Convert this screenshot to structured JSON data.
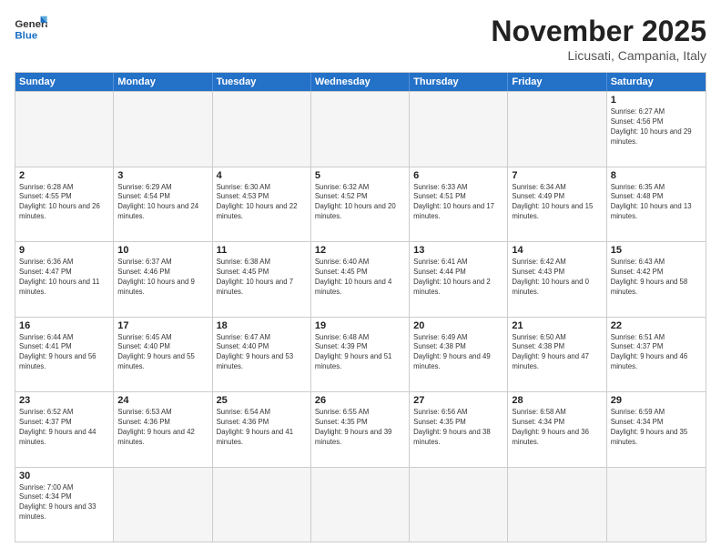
{
  "header": {
    "logo_general": "General",
    "logo_blue": "Blue",
    "month_title": "November 2025",
    "location": "Licusati, Campania, Italy"
  },
  "weekdays": [
    "Sunday",
    "Monday",
    "Tuesday",
    "Wednesday",
    "Thursday",
    "Friday",
    "Saturday"
  ],
  "rows": [
    [
      {
        "day": "",
        "info": "",
        "empty": true
      },
      {
        "day": "",
        "info": "",
        "empty": true
      },
      {
        "day": "",
        "info": "",
        "empty": true
      },
      {
        "day": "",
        "info": "",
        "empty": true
      },
      {
        "day": "",
        "info": "",
        "empty": true
      },
      {
        "day": "",
        "info": "",
        "empty": true
      },
      {
        "day": "1",
        "info": "Sunrise: 6:27 AM\nSunset: 4:56 PM\nDaylight: 10 hours and 29 minutes."
      }
    ],
    [
      {
        "day": "2",
        "info": "Sunrise: 6:28 AM\nSunset: 4:55 PM\nDaylight: 10 hours and 26 minutes."
      },
      {
        "day": "3",
        "info": "Sunrise: 6:29 AM\nSunset: 4:54 PM\nDaylight: 10 hours and 24 minutes."
      },
      {
        "day": "4",
        "info": "Sunrise: 6:30 AM\nSunset: 4:53 PM\nDaylight: 10 hours and 22 minutes."
      },
      {
        "day": "5",
        "info": "Sunrise: 6:32 AM\nSunset: 4:52 PM\nDaylight: 10 hours and 20 minutes."
      },
      {
        "day": "6",
        "info": "Sunrise: 6:33 AM\nSunset: 4:51 PM\nDaylight: 10 hours and 17 minutes."
      },
      {
        "day": "7",
        "info": "Sunrise: 6:34 AM\nSunset: 4:49 PM\nDaylight: 10 hours and 15 minutes."
      },
      {
        "day": "8",
        "info": "Sunrise: 6:35 AM\nSunset: 4:48 PM\nDaylight: 10 hours and 13 minutes."
      }
    ],
    [
      {
        "day": "9",
        "info": "Sunrise: 6:36 AM\nSunset: 4:47 PM\nDaylight: 10 hours and 11 minutes."
      },
      {
        "day": "10",
        "info": "Sunrise: 6:37 AM\nSunset: 4:46 PM\nDaylight: 10 hours and 9 minutes."
      },
      {
        "day": "11",
        "info": "Sunrise: 6:38 AM\nSunset: 4:45 PM\nDaylight: 10 hours and 7 minutes."
      },
      {
        "day": "12",
        "info": "Sunrise: 6:40 AM\nSunset: 4:45 PM\nDaylight: 10 hours and 4 minutes."
      },
      {
        "day": "13",
        "info": "Sunrise: 6:41 AM\nSunset: 4:44 PM\nDaylight: 10 hours and 2 minutes."
      },
      {
        "day": "14",
        "info": "Sunrise: 6:42 AM\nSunset: 4:43 PM\nDaylight: 10 hours and 0 minutes."
      },
      {
        "day": "15",
        "info": "Sunrise: 6:43 AM\nSunset: 4:42 PM\nDaylight: 9 hours and 58 minutes."
      }
    ],
    [
      {
        "day": "16",
        "info": "Sunrise: 6:44 AM\nSunset: 4:41 PM\nDaylight: 9 hours and 56 minutes."
      },
      {
        "day": "17",
        "info": "Sunrise: 6:45 AM\nSunset: 4:40 PM\nDaylight: 9 hours and 55 minutes."
      },
      {
        "day": "18",
        "info": "Sunrise: 6:47 AM\nSunset: 4:40 PM\nDaylight: 9 hours and 53 minutes."
      },
      {
        "day": "19",
        "info": "Sunrise: 6:48 AM\nSunset: 4:39 PM\nDaylight: 9 hours and 51 minutes."
      },
      {
        "day": "20",
        "info": "Sunrise: 6:49 AM\nSunset: 4:38 PM\nDaylight: 9 hours and 49 minutes."
      },
      {
        "day": "21",
        "info": "Sunrise: 6:50 AM\nSunset: 4:38 PM\nDaylight: 9 hours and 47 minutes."
      },
      {
        "day": "22",
        "info": "Sunrise: 6:51 AM\nSunset: 4:37 PM\nDaylight: 9 hours and 46 minutes."
      }
    ],
    [
      {
        "day": "23",
        "info": "Sunrise: 6:52 AM\nSunset: 4:37 PM\nDaylight: 9 hours and 44 minutes."
      },
      {
        "day": "24",
        "info": "Sunrise: 6:53 AM\nSunset: 4:36 PM\nDaylight: 9 hours and 42 minutes."
      },
      {
        "day": "25",
        "info": "Sunrise: 6:54 AM\nSunset: 4:36 PM\nDaylight: 9 hours and 41 minutes."
      },
      {
        "day": "26",
        "info": "Sunrise: 6:55 AM\nSunset: 4:35 PM\nDaylight: 9 hours and 39 minutes."
      },
      {
        "day": "27",
        "info": "Sunrise: 6:56 AM\nSunset: 4:35 PM\nDaylight: 9 hours and 38 minutes."
      },
      {
        "day": "28",
        "info": "Sunrise: 6:58 AM\nSunset: 4:34 PM\nDaylight: 9 hours and 36 minutes."
      },
      {
        "day": "29",
        "info": "Sunrise: 6:59 AM\nSunset: 4:34 PM\nDaylight: 9 hours and 35 minutes."
      }
    ],
    [
      {
        "day": "30",
        "info": "Sunrise: 7:00 AM\nSunset: 4:34 PM\nDaylight: 9 hours and 33 minutes."
      },
      {
        "day": "",
        "info": "",
        "empty": true
      },
      {
        "day": "",
        "info": "",
        "empty": true
      },
      {
        "day": "",
        "info": "",
        "empty": true
      },
      {
        "day": "",
        "info": "",
        "empty": true
      },
      {
        "day": "",
        "info": "",
        "empty": true
      },
      {
        "day": "",
        "info": "",
        "empty": true
      }
    ]
  ]
}
